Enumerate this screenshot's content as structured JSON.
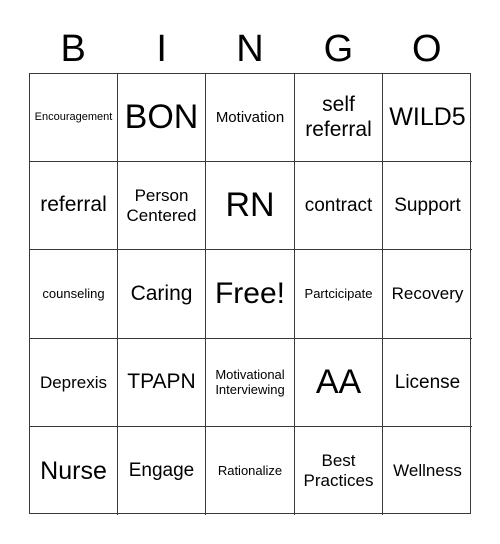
{
  "header": {
    "letters": [
      "B",
      "I",
      "N",
      "G",
      "O"
    ]
  },
  "board": {
    "rows": [
      [
        "Encouragement",
        "BON",
        "Motivation",
        "self referral",
        "WILD5"
      ],
      [
        "referral",
        "Person Centered",
        "RN",
        "contract",
        "Support"
      ],
      [
        "counseling",
        "Caring",
        "Free!",
        "Partcicipate",
        "Recovery"
      ],
      [
        "Deprexis",
        "TPAPN",
        "Motivational Interviewing",
        "AA",
        "License"
      ],
      [
        "Nurse",
        "Engage",
        "Rationalize",
        "Best Practices",
        "Wellness"
      ]
    ],
    "free_space": "Free!"
  }
}
